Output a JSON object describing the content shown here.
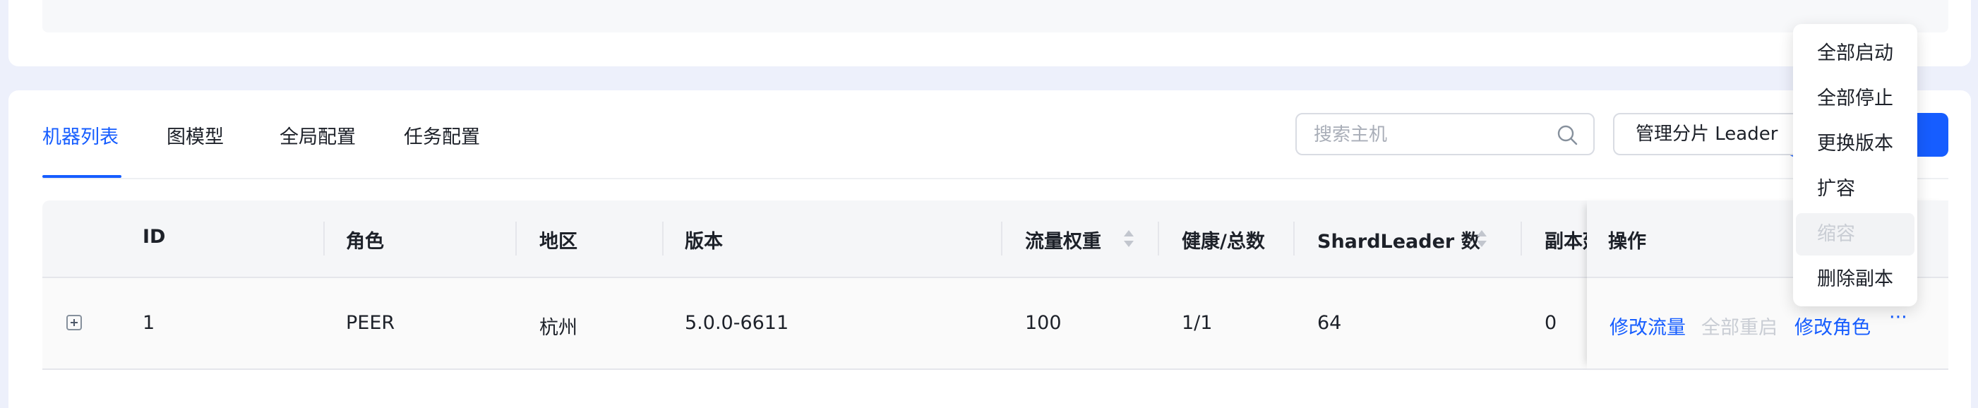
{
  "tabs": [
    {
      "label": "机器列表",
      "active": true
    },
    {
      "label": "图模型"
    },
    {
      "label": "全局配置"
    },
    {
      "label": "任务配置"
    }
  ],
  "search": {
    "placeholder": "搜索主机"
  },
  "toolbar": {
    "shard_leader_label": "管理分片 Leader"
  },
  "table": {
    "headers": {
      "id": "ID",
      "role": "角色",
      "region": "地区",
      "version": "版本",
      "weight": "流量权重",
      "health": "健康/总数",
      "shardleader": "ShardLeader 数",
      "replica": "副本延",
      "actions": "操作"
    },
    "rows": [
      {
        "id": "1",
        "role": "PEER",
        "region": "杭州",
        "version": "5.0.0-6611",
        "weight": "100",
        "health": "1/1",
        "shardleader": "64",
        "replica": "0",
        "actions": {
          "modify_traffic": "修改流量",
          "restart_all": "全部重启",
          "modify_role": "修改角色",
          "more": "···"
        }
      }
    ]
  },
  "dropdown": {
    "items": [
      {
        "label": "全部启动"
      },
      {
        "label": "全部停止"
      },
      {
        "label": "更换版本"
      },
      {
        "label": "扩容"
      },
      {
        "label": "缩容",
        "disabled": true
      },
      {
        "label": "删除副本"
      }
    ]
  },
  "colors": {
    "primary": "#165dff",
    "disabled": "#c9cdd4",
    "background": "#edf0fb"
  }
}
